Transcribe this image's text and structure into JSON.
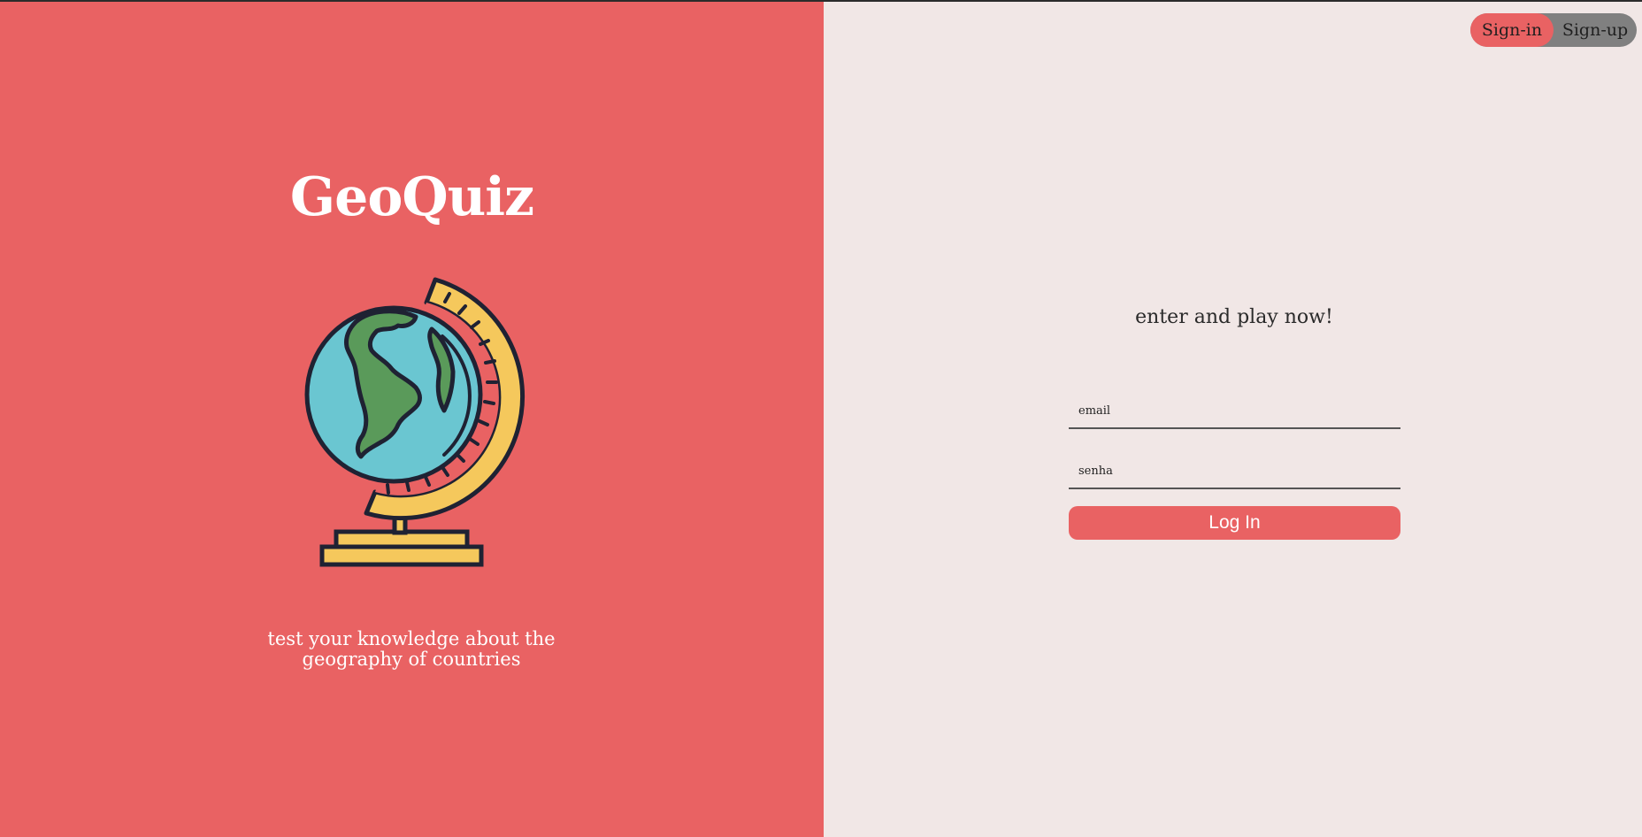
{
  "brand": {
    "title": "GeoQuiz",
    "tagline": "test your knowledge about the geography of countries",
    "illustration_icon": "globe-icon"
  },
  "auth_toggle": {
    "signin_label": "Sign-in",
    "signup_label": "Sign-up",
    "active": "Sign-in"
  },
  "login_form": {
    "heading": "enter and play now!",
    "email_placeholder": "email",
    "password_placeholder": "senha",
    "submit_label": "Log In"
  },
  "colors": {
    "accent": "#e96263",
    "panel_background": "#f1e7e6",
    "toggle_background": "#808080",
    "globe_ocean": "#6ac6d1",
    "globe_land": "#5a9a5a",
    "globe_stand": "#f5c85c",
    "outline": "#1f2233"
  }
}
